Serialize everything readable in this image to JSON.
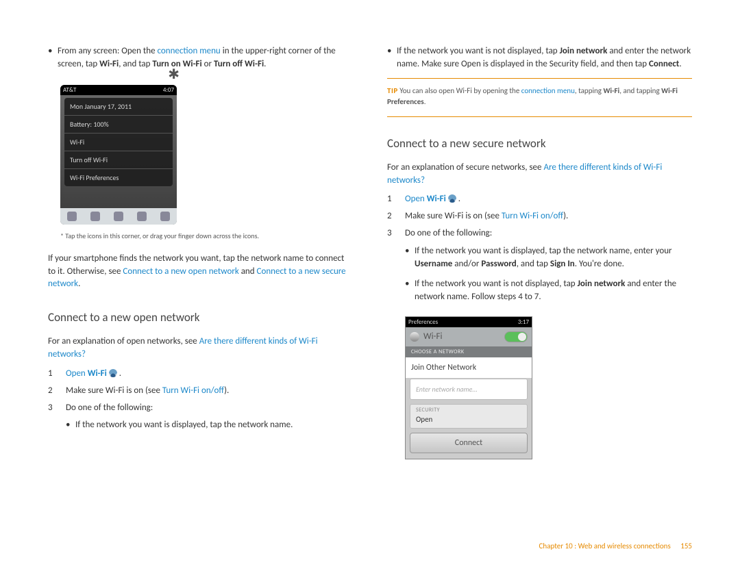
{
  "left": {
    "intro_parts": {
      "a": "From any screen: Open the ",
      "link1": "connection menu",
      "b": " in the upper-right corner of the screen, tap ",
      "bold1": "Wi-Fi",
      "c": ", and tap ",
      "bold2": "Turn on Wi-Fi",
      "d": " or ",
      "bold3": "Turn off Wi-Fi",
      "e": "."
    },
    "phone1": {
      "carrier": "AT&T",
      "time": "4:07",
      "date": "Mon January 17, 2011",
      "battery": "Battery: 100%",
      "wifi": "Wi-Fi",
      "turnoff": "Turn off Wi-Fi",
      "prefs": "Wi-Fi Preferences"
    },
    "caption": "*   Tap the icons in this corner, or drag your finger down across the icons.",
    "after_fig": {
      "a": "If your smartphone finds the network you want, tap the network name to connect to it. Otherwise, see ",
      "link1": "Connect to a new open network",
      "b": " and ",
      "link2": "Connect to a new secure network",
      "c": "."
    },
    "heading": "Connect to a new open network",
    "explain": {
      "a": "For an explanation of open networks, see ",
      "link": "Are there different kinds of Wi-Fi networks?"
    },
    "steps": {
      "s1a": "Open ",
      "s1b": "Wi-Fi",
      "s1c": " .",
      "s2a": "Make sure Wi-Fi is on (see ",
      "s2link": "Turn Wi-Fi on/off",
      "s2b": ").",
      "s3": "Do one of the following:"
    },
    "sub": {
      "a": "If the network you want is displayed, tap the network name."
    }
  },
  "right": {
    "intro": {
      "a": "If the network you want is not displayed, tap ",
      "b1": "Join network",
      "b": " and enter the network name. Make sure Open is displayed in the Security field, and then tap ",
      "b2": "Connect",
      "c": "."
    },
    "tip": {
      "label": "TIP",
      "a": "  You can also open Wi-Fi by opening the ",
      "link": "connection menu",
      "b": ", tapping ",
      "bold1": "Wi-Fi",
      "c": ", and tapping ",
      "bold2": "Wi-Fi Preferences",
      "d": "."
    },
    "heading": "Connect to a new secure network",
    "explain": {
      "a": "For an explanation of secure networks, see ",
      "link": "Are there different kinds of Wi-Fi networks?"
    },
    "steps": {
      "s1a": "Open ",
      "s1b": "Wi-Fi",
      "s1c": " .",
      "s2a": "Make sure Wi-Fi is on (see ",
      "s2link": "Turn Wi-Fi on/off",
      "s2b": ").",
      "s3": "Do one of the following:"
    },
    "sub1": {
      "a": "If the network you want is displayed, tap the network name, enter your ",
      "b1": "Username",
      "b": " and/or ",
      "b2": "Password",
      "c": ", and tap ",
      "b3": "Sign In",
      "d": ". You're done."
    },
    "sub2": {
      "a": "If the network you want is not displayed, tap ",
      "b1": "Join network",
      "b": " and enter the network name. Follow steps 4 to 7."
    },
    "phone2": {
      "left": "Preferences",
      "time": "3:17",
      "title": "Wi-Fi",
      "choose": "CHOOSE A NETWORK",
      "join": "Join Other Network",
      "placeholder": "Enter network name...",
      "sec_label": "SECURITY",
      "sec_val": "Open",
      "connect": "Connect"
    }
  },
  "footer": {
    "chapter": "Chapter 10  :  Web and wireless connections",
    "page": "155"
  }
}
